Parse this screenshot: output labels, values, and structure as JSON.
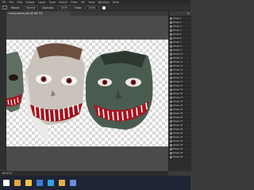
{
  "menubar": {
    "items": [
      "PS",
      "File",
      "Edit",
      "Image",
      "Layer",
      "Type",
      "Select",
      "Filter",
      "3D",
      "View",
      "Window",
      "Help"
    ]
  },
  "options": {
    "mode_label": "Mode:",
    "mode_value": "Normal",
    "opacity_label": "Opacity:",
    "opacity_value": "100%",
    "flow_label": "Flow:",
    "flow_value": "100%"
  },
  "document": {
    "tab_label": "scary-faces.psd @ 66.7%"
  },
  "layers_panel": {
    "title": "Layers",
    "rows": [
      "Shape 1",
      "Shape 2",
      "Shape 3",
      "Shape 4",
      "Shape 5",
      "Shape 6",
      "Shape 7",
      "Shape 8",
      "Shape 9",
      "Shape 10",
      "Shape 11",
      "Shape 12",
      "Shape 13",
      "Shape 14",
      "Shape 15",
      "Shape 16",
      "Shape 17",
      "Shape 18",
      "Shape 19",
      "Shape 20",
      "Shape 21",
      "Shape 22",
      "Shape 23",
      "Shape 24",
      "Shape 25",
      "Shape 26",
      "Shape 27",
      "Shape 28",
      "Shape 29",
      "Shape 30",
      "Shape 31",
      "Shape 32",
      "Shape 33",
      "Shape 34",
      "Shape 35",
      "Shape 36"
    ]
  },
  "status": {
    "text": "66.67%"
  },
  "taskbar": {
    "icons": [
      "start-icon",
      "browser-icon",
      "explorer-icon",
      "mail-icon",
      "photoshop-icon",
      "folder-icon",
      "store-icon"
    ]
  },
  "colors": {
    "accent": "#4a90e2",
    "workspace": "#3a3a3a",
    "taskbar": "#1e2433"
  }
}
